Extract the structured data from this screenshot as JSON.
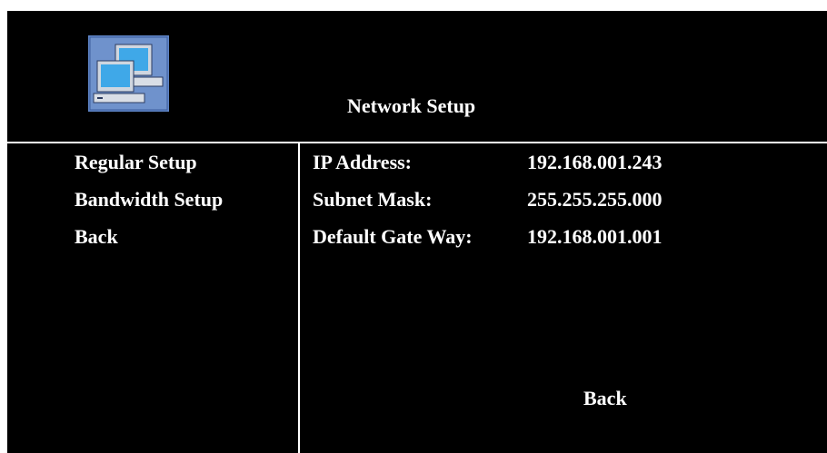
{
  "header": {
    "title": "Network Setup",
    "icon": "network-computers-icon"
  },
  "menu": {
    "items": [
      {
        "label": "Regular Setup"
      },
      {
        "label": "Bandwidth Setup"
      },
      {
        "label": "Back"
      }
    ]
  },
  "network": {
    "rows": [
      {
        "label": "IP Address:",
        "value": "192.168.001.243"
      },
      {
        "label": "Subnet Mask:",
        "value": "255.255.255.000"
      },
      {
        "label": "Default Gate Way:",
        "value": "192.168.001.001"
      }
    ]
  },
  "footer": {
    "back_label": "Back"
  },
  "colors": {
    "background": "#000000",
    "text": "#ffffff",
    "icon_frame": "#4a78c0",
    "icon_screen": "#3fa8e8"
  }
}
